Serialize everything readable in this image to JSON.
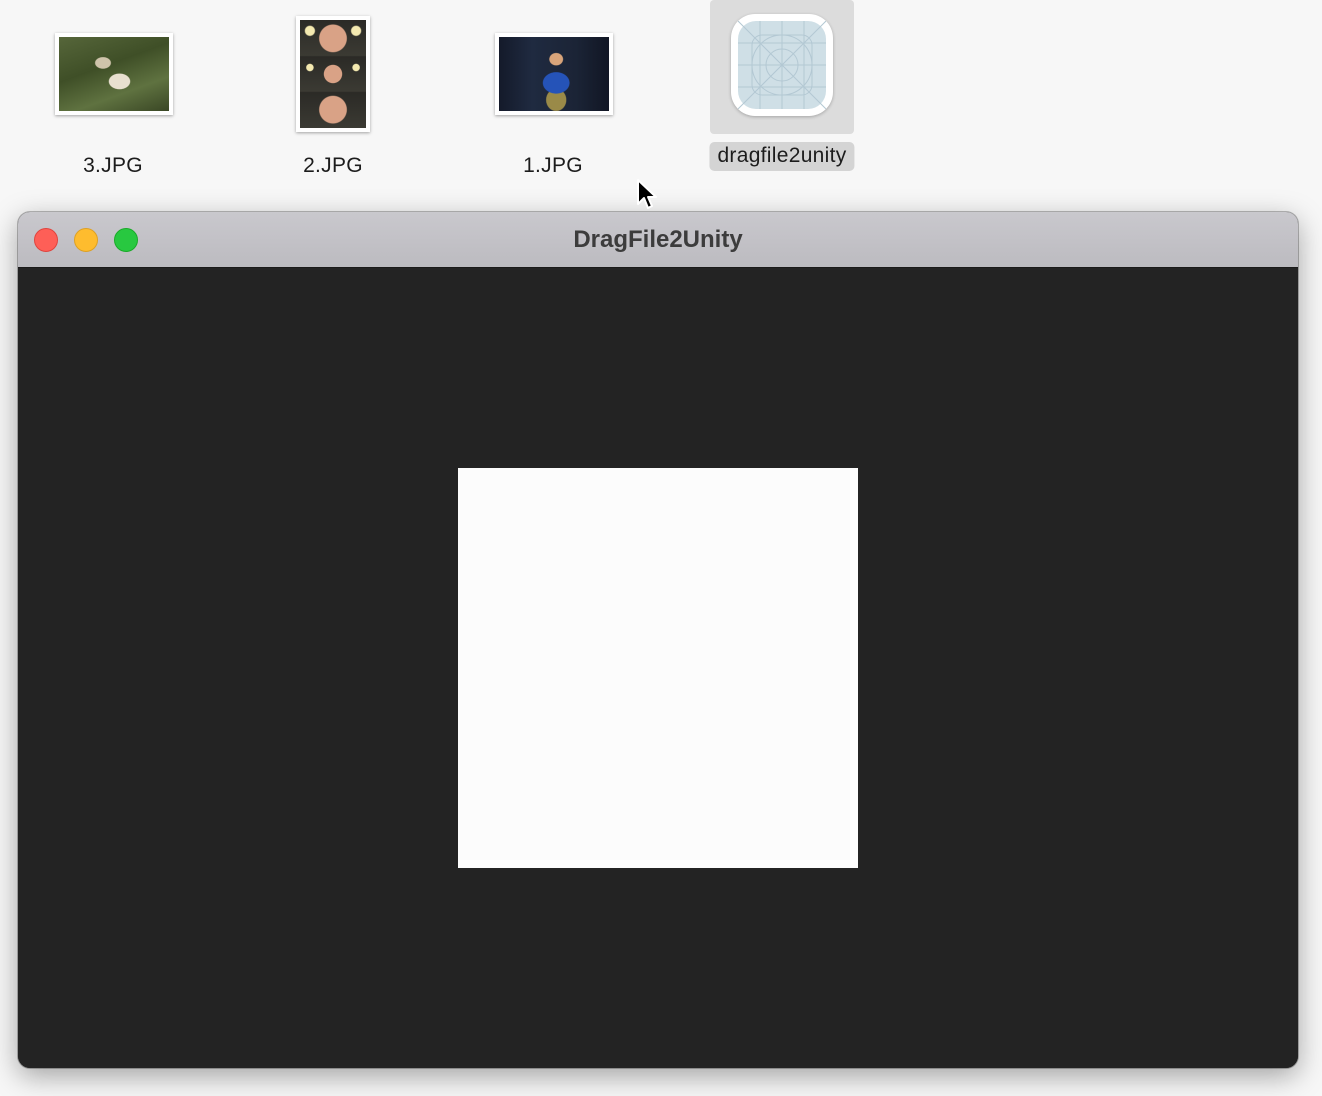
{
  "desktop": {
    "files": [
      {
        "name": "3.JPG"
      },
      {
        "name": "2.JPG"
      },
      {
        "name": "1.JPG"
      },
      {
        "name": "dragfile2unity",
        "selected": true
      }
    ]
  },
  "window": {
    "title": "DragFile2Unity"
  },
  "colors": {
    "window_background": "#232323",
    "titlebar": "#c2c1c6",
    "drop_area": "#fcfcfc",
    "close_button": "#fe5f57",
    "minimize_button": "#febc2e",
    "zoom_button": "#28c840"
  },
  "icons": {
    "app_icon": "app-placeholder-grid-icon",
    "cursor": "arrow-cursor-icon"
  }
}
